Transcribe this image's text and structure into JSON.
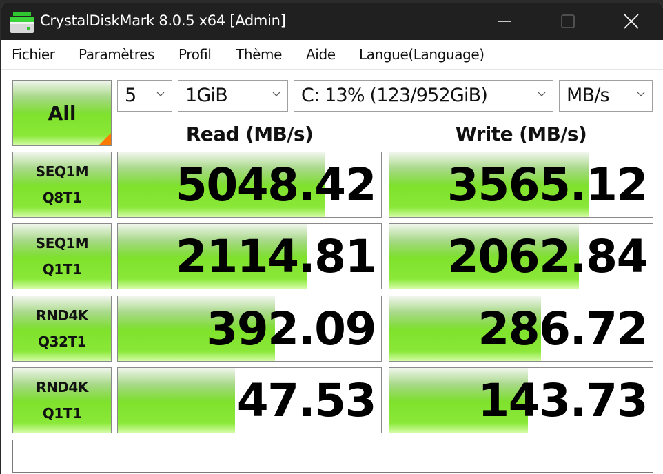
{
  "window": {
    "title": "CrystalDiskMark 8.0.5 x64 [Admin]",
    "icon": "crystaldiskmark-app-icon",
    "controls": [
      "minimize-icon",
      "maximize-icon",
      "close-icon"
    ]
  },
  "menu": {
    "items": [
      {
        "label": "Fichier"
      },
      {
        "label": "Paramètres"
      },
      {
        "label": "Profil"
      },
      {
        "label": "Thème"
      },
      {
        "label": "Aide"
      },
      {
        "label": "Langue(Language)"
      }
    ]
  },
  "toolbar": {
    "all_label": "All",
    "count": {
      "value": "5"
    },
    "size": {
      "value": "1GiB"
    },
    "drive": {
      "value": "C: 13% (123/952GiB)"
    },
    "unit": {
      "value": "MB/s"
    }
  },
  "headers": {
    "read": "Read (MB/s)",
    "write": "Write (MB/s)"
  },
  "tests": [
    {
      "line1": "SEQ1M",
      "line2": "Q8T1",
      "read": {
        "value": "5048.42",
        "meter": 0.785
      },
      "write": {
        "value": "3565.12",
        "meter": 0.759
      }
    },
    {
      "line1": "SEQ1M",
      "line2": "Q1T1",
      "read": {
        "value": "2114.81",
        "meter": 0.72
      },
      "write": {
        "value": "2062.84",
        "meter": 0.72
      }
    },
    {
      "line1": "RND4K",
      "line2": "Q32T1",
      "read": {
        "value": "392.09",
        "meter": 0.597
      },
      "write": {
        "value": "286.72",
        "meter": 0.576
      }
    },
    {
      "line1": "RND4K",
      "line2": "Q1T1",
      "read": {
        "value": "47.53",
        "meter": 0.445
      },
      "write": {
        "value": "143.73",
        "meter": 0.526
      }
    }
  ],
  "comment": {
    "value": ""
  },
  "colors": {
    "bar_green": "#7fe22c",
    "corner_accent": "#ff7a00",
    "titlebar": "#202020"
  }
}
